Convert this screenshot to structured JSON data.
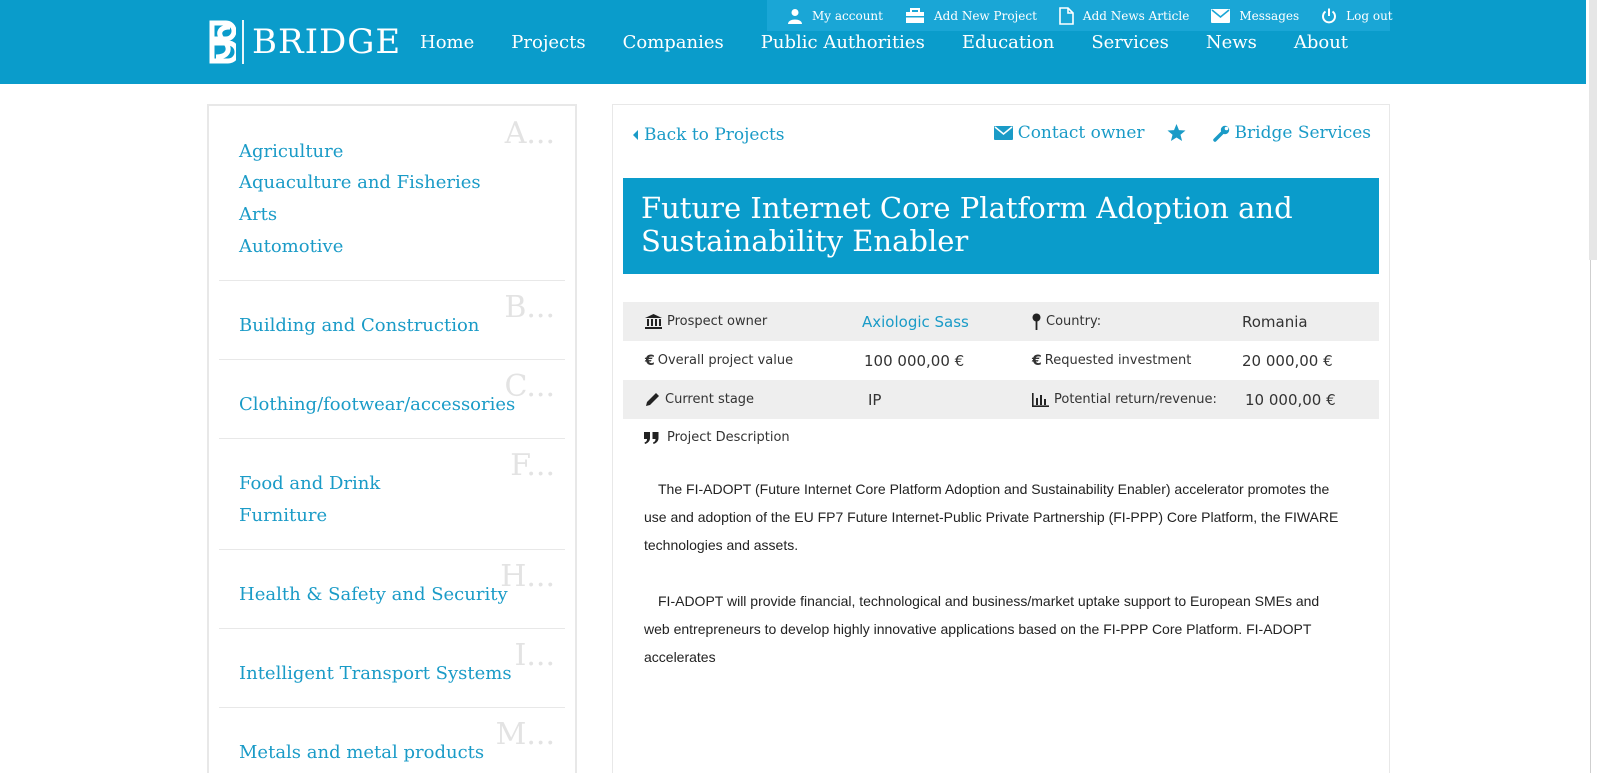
{
  "brand": {
    "name": "BRIDGE"
  },
  "topbar": [
    {
      "label": "My account",
      "icon": "user-icon"
    },
    {
      "label": "Add New Project",
      "icon": "briefcase-icon"
    },
    {
      "label": "Add News Article",
      "icon": "document-icon"
    },
    {
      "label": "Messages",
      "icon": "envelope-icon"
    },
    {
      "label": "Log out",
      "icon": "power-icon"
    }
  ],
  "nav": [
    "Home",
    "Projects",
    "Companies",
    "Public Authorities",
    "Education",
    "Services",
    "News",
    "About"
  ],
  "sidebar": [
    {
      "letter": "A...",
      "items": [
        "Agriculture",
        "Aquaculture and Fisheries",
        "Arts",
        "Automotive"
      ]
    },
    {
      "letter": "B...",
      "items": [
        "Building and Construction"
      ]
    },
    {
      "letter": "C...",
      "items": [
        "Clothing/footwear/accessories"
      ]
    },
    {
      "letter": "F...",
      "items": [
        "Food and Drink",
        "Furniture"
      ]
    },
    {
      "letter": "H...",
      "items": [
        "Health & Safety and Security"
      ]
    },
    {
      "letter": "I...",
      "items": [
        "Intelligent Transport Systems"
      ]
    },
    {
      "letter": "M...",
      "items": [
        "Metals and metal products"
      ]
    }
  ],
  "panel": {
    "back_label": "Back to Projects",
    "contact_label": "Contact owner",
    "services_label": "Bridge Services",
    "title": "Future Internet Core Platform Adoption and Sustainability Enabler"
  },
  "info": {
    "owner_label": "Prospect owner",
    "owner_value": "Axiologic Sass",
    "country_label": "Country:",
    "country_value": "Romania",
    "overall_label": "Overall project value",
    "overall_value": "100 000,00 €",
    "requested_label": "Requested investment",
    "requested_value": "20 000,00 €",
    "stage_label": "Current stage",
    "stage_value": "IP",
    "return_label": "Potential return/revenue:",
    "return_value": "10 000,00 €"
  },
  "description": {
    "label": "Project Description",
    "p1": "The FI-ADOPT (Future Internet Core Platform Adoption and Sustainability Enabler) accelerator promotes the use and adoption of the EU FP7 Future Internet-Public Private Partnership (FI-PPP) Core Platform, the FIWARE technologies and assets.",
    "p2": "FI-ADOPT will provide financial, technological and business/market uptake support to European SMEs and web entrepreneurs to develop highly innovative applications based on the FI-PPP Core Platform. FI-ADOPT accelerates"
  },
  "colors": {
    "brand": "#0a9ccb",
    "link": "#1a9bc7"
  }
}
